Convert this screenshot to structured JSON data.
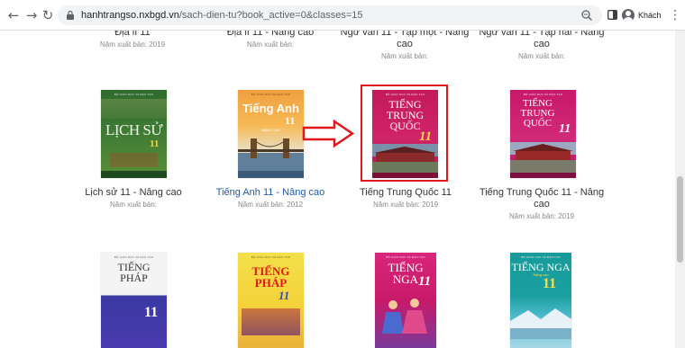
{
  "browser": {
    "url_host": "hanhtrangso.nxbgd.vn",
    "url_path": "/sach-dien-tu?book_active=0&classes=15",
    "profile_label": "Khách",
    "icons": [
      "back-icon",
      "forward-icon",
      "reload-icon",
      "lock-icon",
      "zoom-icon",
      "side-panel-icon",
      "profile-icon",
      "menu-icon"
    ]
  },
  "books_row1": [
    {
      "title": "Địa lí 11",
      "year_label": "Năm xuất bản: 2019"
    },
    {
      "title": "Địa lí 11 - Nâng cao",
      "year_label": "Năm xuất bản:"
    },
    {
      "title": "Ngữ văn 11 - Tập một - Nâng cao",
      "year_label": "Năm xuất bản:"
    },
    {
      "title": "Ngữ văn 11 - Tập hai - Nâng cao",
      "year_label": "Năm xuất bản:"
    }
  ],
  "books_row2": [
    {
      "title": "Lịch sử 11 - Nâng cao",
      "year_label": "Năm xuất bản:",
      "cover_title": "LỊCH SỬ",
      "cover_num": "11"
    },
    {
      "title": "Tiếng Anh 11 - Nâng cao",
      "year_label": "Năm xuất bản: 2012",
      "cover_title": "Tiếng Anh",
      "cover_num": "11",
      "cover_sub": "NÂNG CAO"
    },
    {
      "title": "Tiếng Trung Quốc 11",
      "year_label": "Năm xuất bản: 2019",
      "cover_title_1": "TIẾNG",
      "cover_title_2": "TRUNG",
      "cover_title_3": "QUỐC",
      "cover_num": "11"
    },
    {
      "title": "Tiếng Trung Quốc 11 - Nâng cao",
      "year_label": "Năm xuất bản: 2019",
      "cover_title_1": "TIẾNG",
      "cover_title_2": "TRUNG",
      "cover_title_3": "QUỐC",
      "cover_num": "11"
    }
  ],
  "books_row3": [
    {
      "cover_title_1": "TIẾNG",
      "cover_title_2": "PHÁP",
      "cover_num": "11"
    },
    {
      "cover_title_1": "TIẾNG",
      "cover_title_2": "PHÁP",
      "cover_num": "11"
    },
    {
      "cover_title": "TIẾNG NGA",
      "cover_num": "11"
    },
    {
      "cover_title": "TIẾNG NGA",
      "cover_num": "11",
      "cover_sub": "Nâng cao"
    }
  ],
  "colors": {
    "highlight": "#e0171b",
    "link_title": "#1f5ba8"
  }
}
